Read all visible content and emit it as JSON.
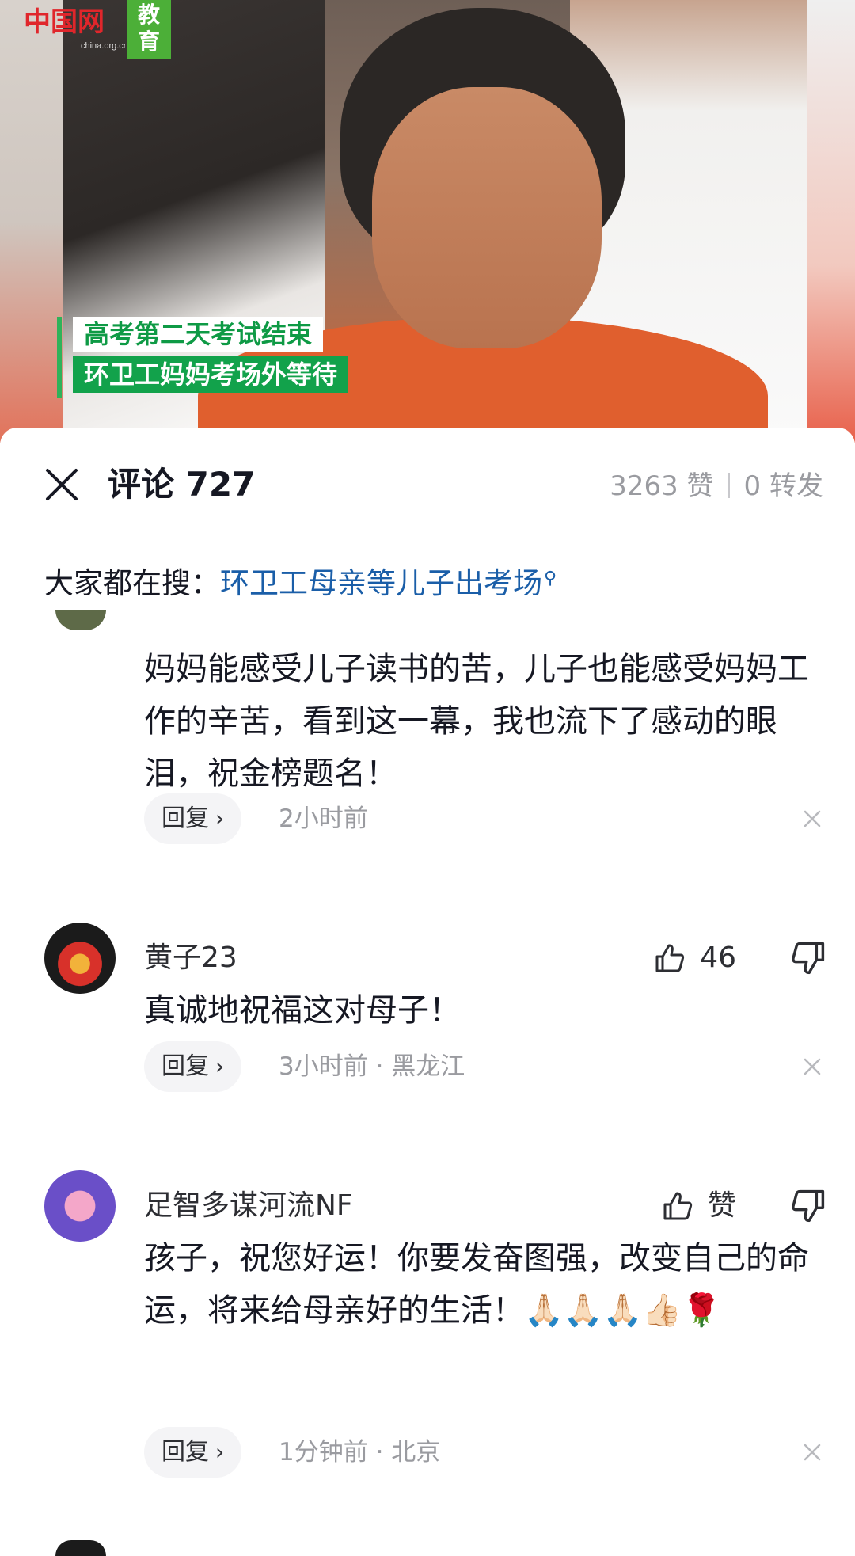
{
  "video": {
    "logo_url": "china.org.cn",
    "logo_tag": "教育",
    "caption_line1": "高考第二天考试结束",
    "caption_line2": "环卫工妈妈考场外等待"
  },
  "header": {
    "title": "评论 727",
    "likes": "3263 赞",
    "shares": "0 转发"
  },
  "search": {
    "label": "大家都在搜：",
    "term": "环卫工母亲等儿子出考场"
  },
  "comments": [
    {
      "username": "",
      "text": "妈妈能感受儿子读书的苦，儿子也能感受妈妈工作的辛苦，看到这一幕，我也流下了感动的眼泪，祝金榜题名！",
      "reply_label": "回复",
      "meta": "2小时前"
    },
    {
      "username": "黄子23",
      "like_count": "46",
      "text": "真诚地祝福这对母子！",
      "reply_label": "回复",
      "meta": "3小时前 · 黑龙江"
    },
    {
      "username": "足智多谋河流NF",
      "like_count": "赞",
      "text": "孩子，祝您好运！你要发奋图强，改变自己的命运，将来给母亲好的生活！",
      "emojis": "🙏🏻🙏🏻🙏🏻👍🏻🌹",
      "reply_label": "回复",
      "meta": "1分钟前 · 北京"
    }
  ],
  "colors": {
    "accent_link": "#1a5ea8",
    "caption_green": "#12a24b",
    "muted_text": "#9a9ba0"
  }
}
